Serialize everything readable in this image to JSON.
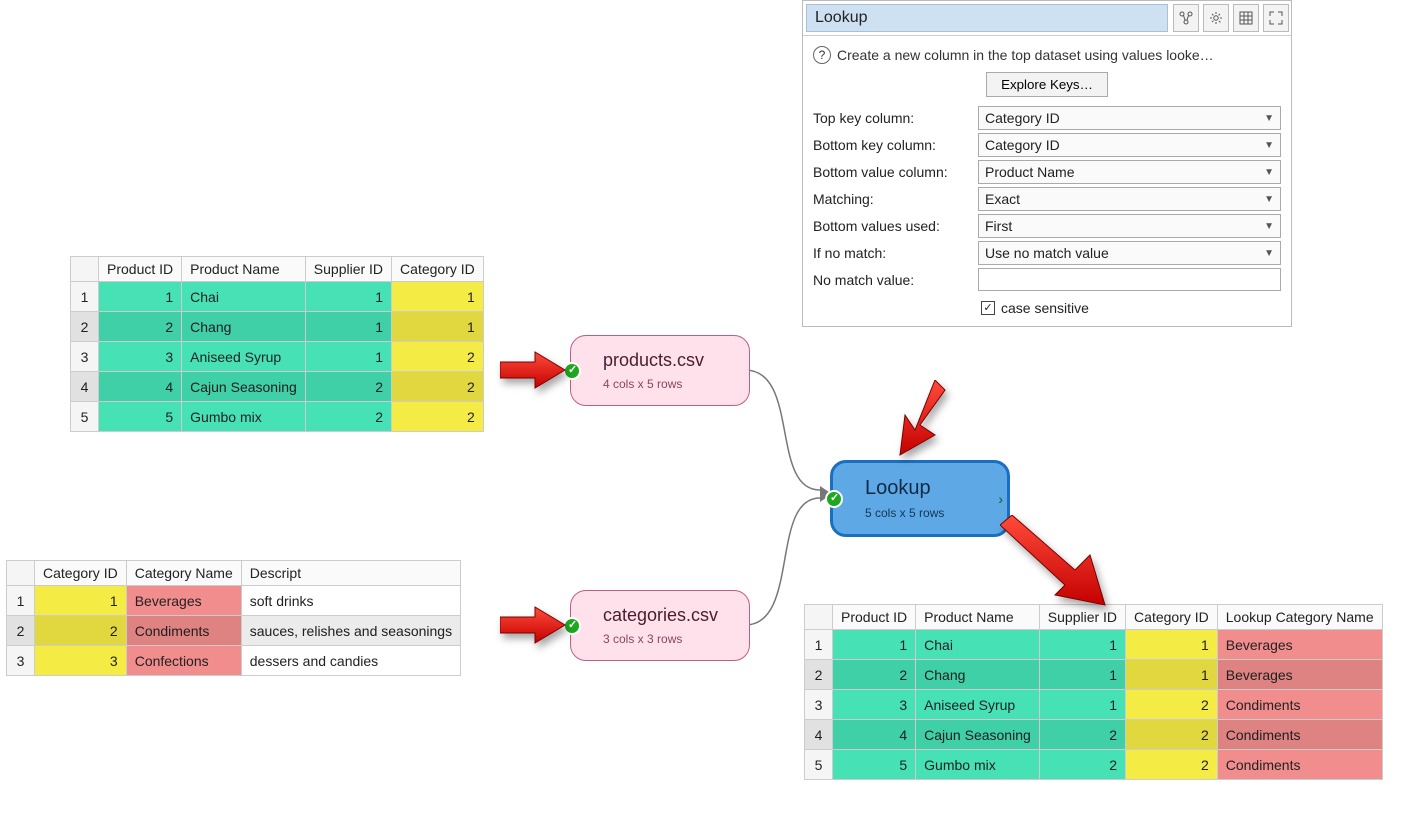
{
  "panel": {
    "title": "Lookup",
    "info": "Create a new column in the top dataset using values looke…",
    "explore_btn": "Explore Keys…",
    "fields": {
      "top_key_label": "Top key column:",
      "top_key_value": "Category ID",
      "bottom_key_label": "Bottom key column:",
      "bottom_key_value": "Category ID",
      "bottom_value_label": "Bottom value column:",
      "bottom_value_value": "Product Name",
      "matching_label": "Matching:",
      "matching_value": "Exact",
      "bottom_used_label": "Bottom values used:",
      "bottom_used_value": "First",
      "nomatch_label": "If no match:",
      "nomatch_value": "Use no match value",
      "nomatch_v_label": "No match value:",
      "nomatch_v_value": "",
      "case_label": "case sensitive",
      "case_checked": "✓"
    },
    "icons": [
      "links-icon",
      "gear-icon",
      "grid-icon",
      "expand-icon"
    ]
  },
  "nodes": {
    "products": {
      "title": "products.csv",
      "sub": "4 cols x 5 rows"
    },
    "categories": {
      "title": "categories.csv",
      "sub": "3 cols x 3 rows"
    },
    "lookup": {
      "title": "Lookup",
      "sub": "5 cols x 5 rows"
    }
  },
  "tables": {
    "products": {
      "headers": [
        "Product ID",
        "Product Name",
        "Supplier ID",
        "Category ID"
      ],
      "rows": [
        {
          "pid": "1",
          "pname": "Chai",
          "sid": "1",
          "cid": "1"
        },
        {
          "pid": "2",
          "pname": "Chang",
          "sid": "1",
          "cid": "1"
        },
        {
          "pid": "3",
          "pname": "Aniseed Syrup",
          "sid": "1",
          "cid": "2"
        },
        {
          "pid": "4",
          "pname": "Cajun Seasoning",
          "sid": "2",
          "cid": "2"
        },
        {
          "pid": "5",
          "pname": "Gumbo mix",
          "sid": "2",
          "cid": "2"
        }
      ]
    },
    "categories": {
      "headers": [
        "Category ID",
        "Category Name",
        "Descript"
      ],
      "rows": [
        {
          "cid": "1",
          "cname": "Beverages",
          "desc": "soft drinks"
        },
        {
          "cid": "2",
          "cname": "Condiments",
          "desc": "sauces, relishes and seasonings"
        },
        {
          "cid": "3",
          "cname": "Confections",
          "desc": "dessers and candies"
        }
      ]
    },
    "result": {
      "headers": [
        "Product ID",
        "Product Name",
        "Supplier ID",
        "Category ID",
        "Lookup Category Name"
      ],
      "rows": [
        {
          "pid": "1",
          "pname": "Chai",
          "sid": "1",
          "cid": "1",
          "lc": "Beverages"
        },
        {
          "pid": "2",
          "pname": "Chang",
          "sid": "1",
          "cid": "1",
          "lc": "Beverages"
        },
        {
          "pid": "3",
          "pname": "Aniseed Syrup",
          "sid": "1",
          "cid": "2",
          "lc": "Condiments"
        },
        {
          "pid": "4",
          "pname": "Cajun Seasoning",
          "sid": "2",
          "cid": "2",
          "lc": "Condiments"
        },
        {
          "pid": "5",
          "pname": "Gumbo mix",
          "sid": "2",
          "cid": "2",
          "lc": "Condiments"
        }
      ]
    }
  },
  "chart_data": {
    "type": "table",
    "note": "Diagram shows three data tables connected through a Lookup node. Data values captured in tables.* above."
  }
}
